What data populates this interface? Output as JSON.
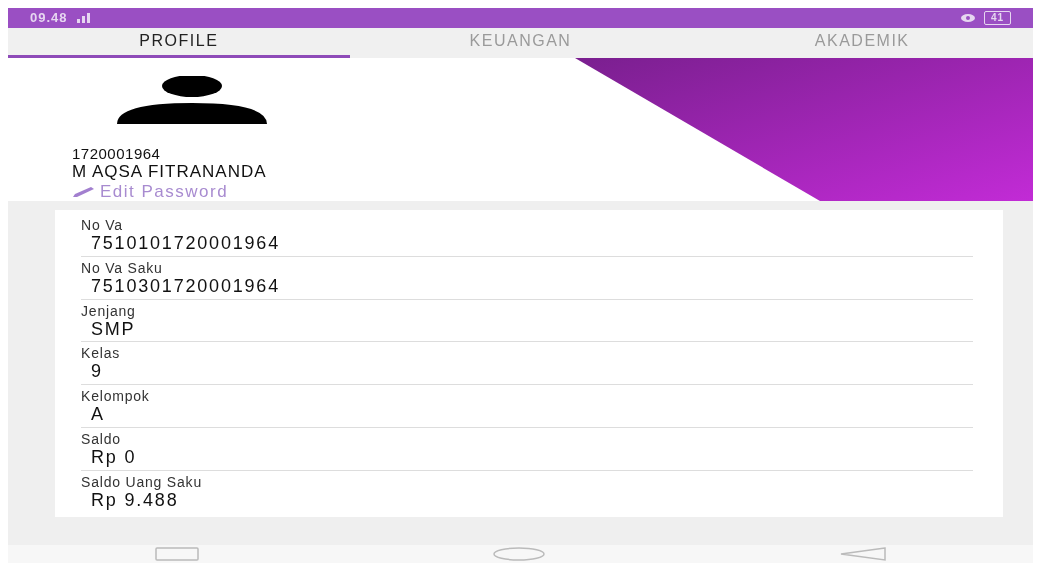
{
  "status_bar": {
    "time": "09.48",
    "battery": "41"
  },
  "tabs": [
    {
      "label": "PROFILE",
      "selected": true
    },
    {
      "label": "KEUANGAN",
      "selected": false
    },
    {
      "label": "AKADEMIK",
      "selected": false
    }
  ],
  "profile": {
    "id": "1720001964",
    "name": "M AQSA FITRANANDA",
    "edit_link": "Edit Password"
  },
  "fields": [
    {
      "label": "No Va",
      "value": "7510101720001964"
    },
    {
      "label": "No Va Saku",
      "value": "7510301720001964"
    },
    {
      "label": "Jenjang",
      "value": "SMP"
    },
    {
      "label": "Kelas",
      "value": "9"
    },
    {
      "label": "Kelompok",
      "value": "A"
    },
    {
      "label": "Saldo",
      "value": "Rp 0"
    },
    {
      "label": "Saldo Uang Saku",
      "value": "Rp 9.488"
    }
  ]
}
